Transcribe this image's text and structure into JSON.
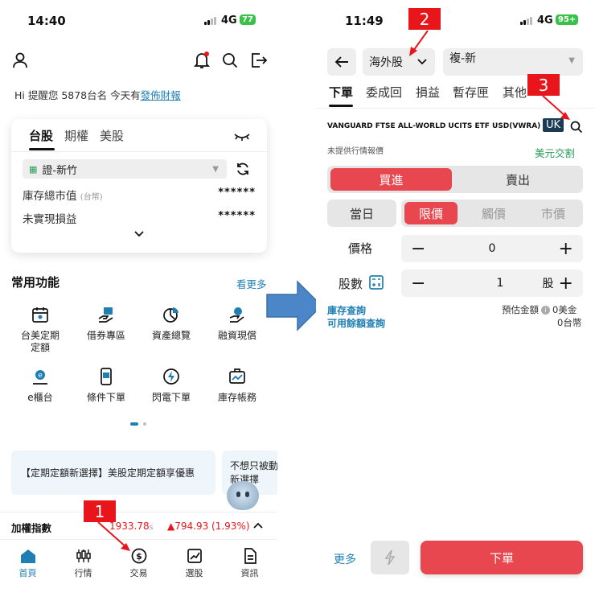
{
  "left": {
    "status": {
      "time": "14:40",
      "network": "4G",
      "battery": "77"
    },
    "greeting": {
      "text": "Hi 提醒您 5878台名 今天有",
      "link": "發佈財報"
    },
    "card": {
      "tabs": [
        "台股",
        "期權",
        "美股"
      ],
      "account": "證-新竹",
      "rows": [
        {
          "label": "庫存總市值",
          "sub": "(台幣)",
          "value": "******"
        },
        {
          "label": "未實現損益",
          "sub": "",
          "value": "******"
        }
      ]
    },
    "functions": {
      "title": "常用功能",
      "more": "看更多",
      "items": [
        "台美定期\n定額",
        "借券專區",
        "資產總覽",
        "融資現償",
        "e櫃台",
        "條件下單",
        "閃電下單",
        "庫存帳務"
      ]
    },
    "banners": [
      "【定期定額新選擇】美股定期定額享優惠",
      "不想只被動\n新選擇"
    ],
    "index": {
      "label": "加權指數",
      "value": "1933.78",
      "unit": "s",
      "change": "794.93 (1.93%)"
    },
    "tabbar": [
      "首頁",
      "行情",
      "交易",
      "選股",
      "資訊"
    ]
  },
  "right": {
    "status": {
      "time": "11:49",
      "network": "4G",
      "battery": "95+"
    },
    "market_select": "海外股",
    "account_select": "複-新",
    "tabs": [
      "下單",
      "委成回",
      "損益",
      "暫存匣",
      "其他"
    ],
    "stock": {
      "name": "VANGUARD FTSE ALL-WORLD UCITS ETF USD(VWRA)",
      "market_badge": "UK"
    },
    "quote_note": "未提供行情報價",
    "settlement": "美元交割",
    "side": {
      "buy": "買進",
      "sell": "賣出"
    },
    "session": "當日",
    "price_types": [
      "限價",
      "觸價",
      "市價"
    ],
    "price": {
      "label": "價格",
      "value": "0"
    },
    "qty": {
      "label": "股數",
      "value": "1",
      "unit": "股"
    },
    "links": [
      "庫存查詢",
      "可用餘額查詢"
    ],
    "estimate": {
      "label": "預估金額",
      "usd": "0美金",
      "twd": "0台幣"
    },
    "more": "更多",
    "submit": "下單"
  },
  "markers": [
    "1",
    "2",
    "3"
  ],
  "colors": {
    "accent_red": "#e9474f",
    "link_blue": "#1f7fb3",
    "marker_red": "#e8161b",
    "arrow_blue": "#4a86c8"
  }
}
